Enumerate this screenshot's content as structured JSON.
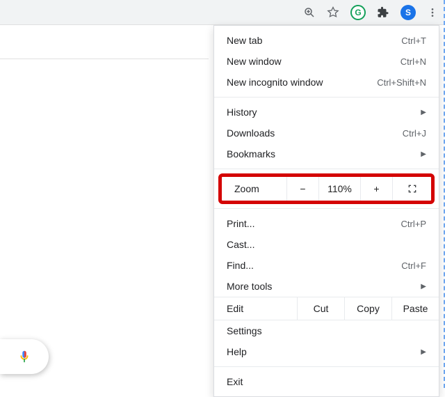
{
  "toolbar": {
    "ext_grammarly": "G",
    "profile_letter": "S"
  },
  "menu": {
    "new_tab": {
      "label": "New tab",
      "shortcut": "Ctrl+T"
    },
    "new_window": {
      "label": "New window",
      "shortcut": "Ctrl+N"
    },
    "incognito": {
      "label": "New incognito window",
      "shortcut": "Ctrl+Shift+N"
    },
    "history": {
      "label": "History"
    },
    "downloads": {
      "label": "Downloads",
      "shortcut": "Ctrl+J"
    },
    "bookmarks": {
      "label": "Bookmarks"
    },
    "zoom": {
      "label": "Zoom",
      "minus": "−",
      "value": "110%",
      "plus": "+"
    },
    "print": {
      "label": "Print...",
      "shortcut": "Ctrl+P"
    },
    "cast": {
      "label": "Cast..."
    },
    "find": {
      "label": "Find...",
      "shortcut": "Ctrl+F"
    },
    "more_tools": {
      "label": "More tools"
    },
    "edit": {
      "label": "Edit",
      "cut": "Cut",
      "copy": "Copy",
      "paste": "Paste"
    },
    "settings": {
      "label": "Settings"
    },
    "help": {
      "label": "Help"
    },
    "exit": {
      "label": "Exit"
    }
  }
}
